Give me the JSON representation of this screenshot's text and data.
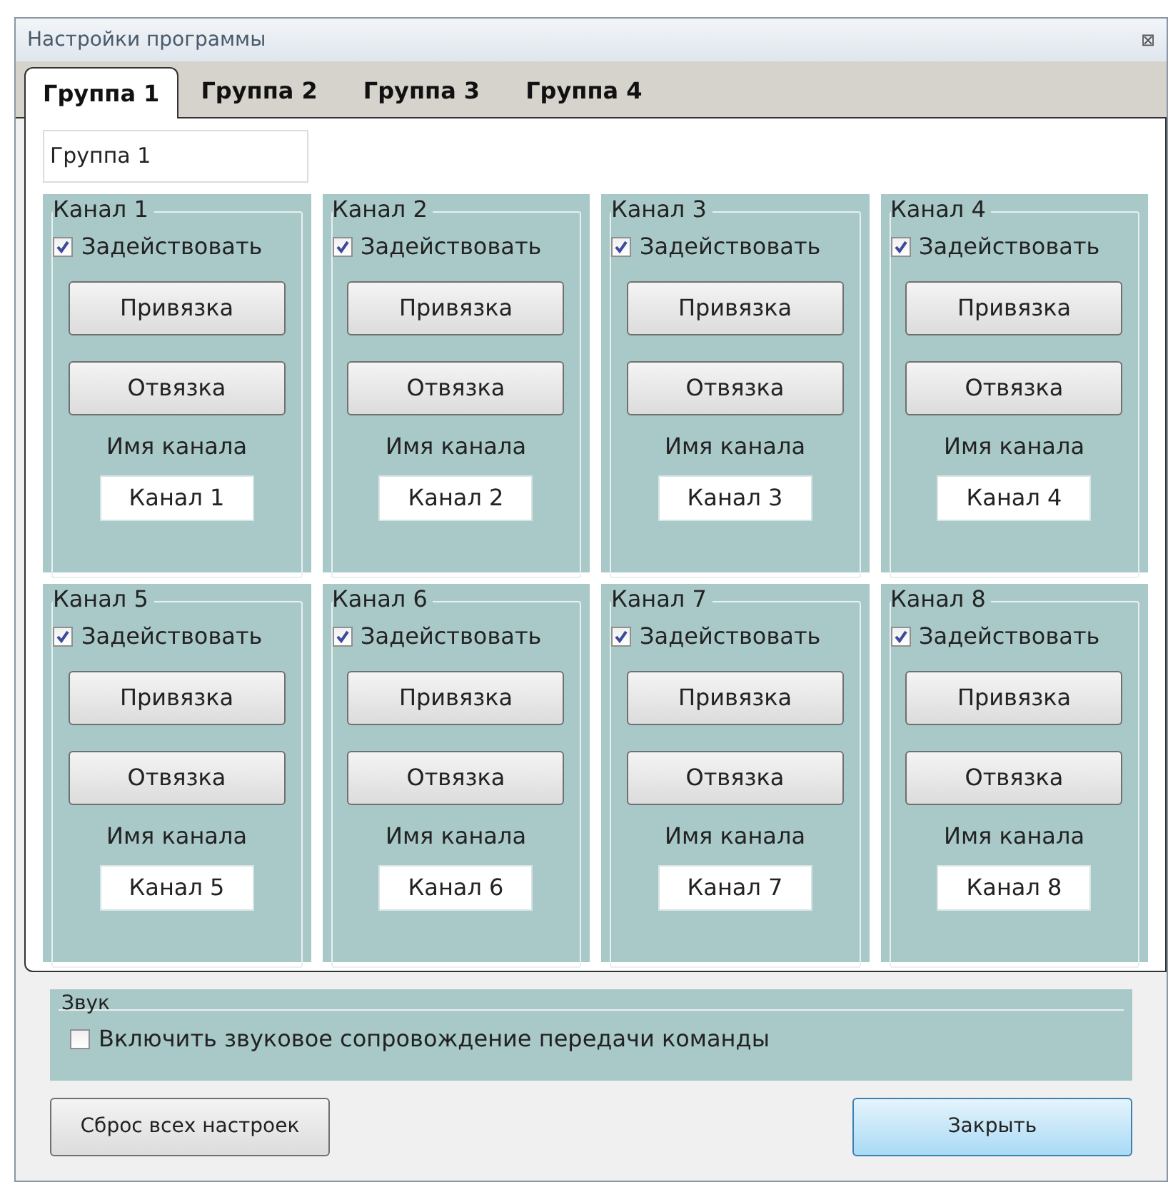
{
  "window": {
    "title": "Настройки программы",
    "close": "⊠"
  },
  "tabs": [
    {
      "label": "Группа 1",
      "selected": true
    },
    {
      "label": "Группа 2",
      "selected": false
    },
    {
      "label": "Группа 3",
      "selected": false
    },
    {
      "label": "Группа 4",
      "selected": false
    }
  ],
  "group_name": "Группа 1",
  "channels": [
    {
      "title": "Канал 1",
      "enable_label": "Задействовать",
      "enabled": true,
      "bind": "Привязка",
      "unbind": "Отвязка",
      "name_label": "Имя канала",
      "name": "Канал 1"
    },
    {
      "title": "Канал 2",
      "enable_label": "Задействовать",
      "enabled": true,
      "bind": "Привязка",
      "unbind": "Отвязка",
      "name_label": "Имя канала",
      "name": "Канал 2"
    },
    {
      "title": "Канал 3",
      "enable_label": "Задействовать",
      "enabled": true,
      "bind": "Привязка",
      "unbind": "Отвязка",
      "name_label": "Имя канала",
      "name": "Канал 3"
    },
    {
      "title": "Канал 4",
      "enable_label": "Задействовать",
      "enabled": true,
      "bind": "Привязка",
      "unbind": "Отвязка",
      "name_label": "Имя канала",
      "name": "Канал 4"
    },
    {
      "title": "Канал 5",
      "enable_label": "Задействовать",
      "enabled": true,
      "bind": "Привязка",
      "unbind": "Отвязка",
      "name_label": "Имя канала",
      "name": "Канал 5"
    },
    {
      "title": "Канал 6",
      "enable_label": "Задействовать",
      "enabled": true,
      "bind": "Привязка",
      "unbind": "Отвязка",
      "name_label": "Имя канала",
      "name": "Канал 6"
    },
    {
      "title": "Канал 7",
      "enable_label": "Задействовать",
      "enabled": true,
      "bind": "Привязка",
      "unbind": "Отвязка",
      "name_label": "Имя канала",
      "name": "Канал 7"
    },
    {
      "title": "Канал 8",
      "enable_label": "Задействовать",
      "enabled": true,
      "bind": "Привязка",
      "unbind": "Отвязка",
      "name_label": "Имя канала",
      "name": "Канал 8"
    }
  ],
  "sound": {
    "title": "Звук",
    "label": "Включить звуковое сопровождение передачи команды",
    "checked": false
  },
  "buttons": {
    "reset": "Сброс всех настроек",
    "close": "Закрыть"
  }
}
